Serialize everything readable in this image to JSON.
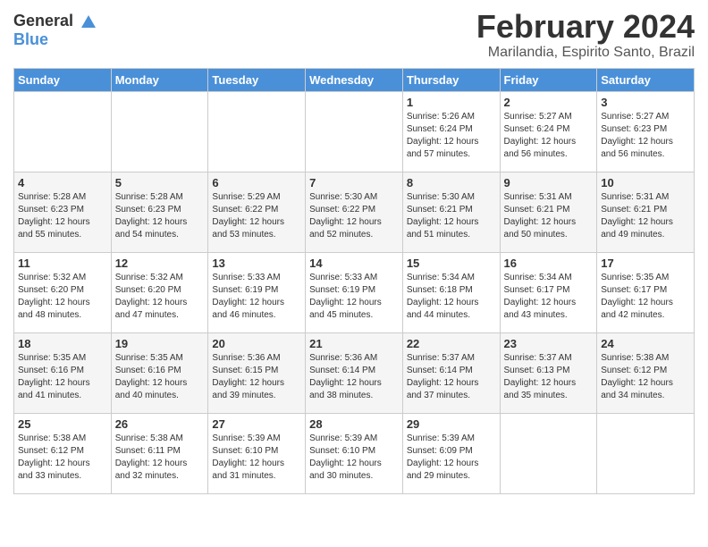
{
  "header": {
    "logo_general": "General",
    "logo_blue": "Blue",
    "month_title": "February 2024",
    "location": "Marilandia, Espirito Santo, Brazil"
  },
  "days_of_week": [
    "Sunday",
    "Monday",
    "Tuesday",
    "Wednesday",
    "Thursday",
    "Friday",
    "Saturday"
  ],
  "weeks": [
    [
      {
        "day": "",
        "info": ""
      },
      {
        "day": "",
        "info": ""
      },
      {
        "day": "",
        "info": ""
      },
      {
        "day": "",
        "info": ""
      },
      {
        "day": "1",
        "info": "Sunrise: 5:26 AM\nSunset: 6:24 PM\nDaylight: 12 hours\nand 57 minutes."
      },
      {
        "day": "2",
        "info": "Sunrise: 5:27 AM\nSunset: 6:24 PM\nDaylight: 12 hours\nand 56 minutes."
      },
      {
        "day": "3",
        "info": "Sunrise: 5:27 AM\nSunset: 6:23 PM\nDaylight: 12 hours\nand 56 minutes."
      }
    ],
    [
      {
        "day": "4",
        "info": "Sunrise: 5:28 AM\nSunset: 6:23 PM\nDaylight: 12 hours\nand 55 minutes."
      },
      {
        "day": "5",
        "info": "Sunrise: 5:28 AM\nSunset: 6:23 PM\nDaylight: 12 hours\nand 54 minutes."
      },
      {
        "day": "6",
        "info": "Sunrise: 5:29 AM\nSunset: 6:22 PM\nDaylight: 12 hours\nand 53 minutes."
      },
      {
        "day": "7",
        "info": "Sunrise: 5:30 AM\nSunset: 6:22 PM\nDaylight: 12 hours\nand 52 minutes."
      },
      {
        "day": "8",
        "info": "Sunrise: 5:30 AM\nSunset: 6:21 PM\nDaylight: 12 hours\nand 51 minutes."
      },
      {
        "day": "9",
        "info": "Sunrise: 5:31 AM\nSunset: 6:21 PM\nDaylight: 12 hours\nand 50 minutes."
      },
      {
        "day": "10",
        "info": "Sunrise: 5:31 AM\nSunset: 6:21 PM\nDaylight: 12 hours\nand 49 minutes."
      }
    ],
    [
      {
        "day": "11",
        "info": "Sunrise: 5:32 AM\nSunset: 6:20 PM\nDaylight: 12 hours\nand 48 minutes."
      },
      {
        "day": "12",
        "info": "Sunrise: 5:32 AM\nSunset: 6:20 PM\nDaylight: 12 hours\nand 47 minutes."
      },
      {
        "day": "13",
        "info": "Sunrise: 5:33 AM\nSunset: 6:19 PM\nDaylight: 12 hours\nand 46 minutes."
      },
      {
        "day": "14",
        "info": "Sunrise: 5:33 AM\nSunset: 6:19 PM\nDaylight: 12 hours\nand 45 minutes."
      },
      {
        "day": "15",
        "info": "Sunrise: 5:34 AM\nSunset: 6:18 PM\nDaylight: 12 hours\nand 44 minutes."
      },
      {
        "day": "16",
        "info": "Sunrise: 5:34 AM\nSunset: 6:17 PM\nDaylight: 12 hours\nand 43 minutes."
      },
      {
        "day": "17",
        "info": "Sunrise: 5:35 AM\nSunset: 6:17 PM\nDaylight: 12 hours\nand 42 minutes."
      }
    ],
    [
      {
        "day": "18",
        "info": "Sunrise: 5:35 AM\nSunset: 6:16 PM\nDaylight: 12 hours\nand 41 minutes."
      },
      {
        "day": "19",
        "info": "Sunrise: 5:35 AM\nSunset: 6:16 PM\nDaylight: 12 hours\nand 40 minutes."
      },
      {
        "day": "20",
        "info": "Sunrise: 5:36 AM\nSunset: 6:15 PM\nDaylight: 12 hours\nand 39 minutes."
      },
      {
        "day": "21",
        "info": "Sunrise: 5:36 AM\nSunset: 6:14 PM\nDaylight: 12 hours\nand 38 minutes."
      },
      {
        "day": "22",
        "info": "Sunrise: 5:37 AM\nSunset: 6:14 PM\nDaylight: 12 hours\nand 37 minutes."
      },
      {
        "day": "23",
        "info": "Sunrise: 5:37 AM\nSunset: 6:13 PM\nDaylight: 12 hours\nand 35 minutes."
      },
      {
        "day": "24",
        "info": "Sunrise: 5:38 AM\nSunset: 6:12 PM\nDaylight: 12 hours\nand 34 minutes."
      }
    ],
    [
      {
        "day": "25",
        "info": "Sunrise: 5:38 AM\nSunset: 6:12 PM\nDaylight: 12 hours\nand 33 minutes."
      },
      {
        "day": "26",
        "info": "Sunrise: 5:38 AM\nSunset: 6:11 PM\nDaylight: 12 hours\nand 32 minutes."
      },
      {
        "day": "27",
        "info": "Sunrise: 5:39 AM\nSunset: 6:10 PM\nDaylight: 12 hours\nand 31 minutes."
      },
      {
        "day": "28",
        "info": "Sunrise: 5:39 AM\nSunset: 6:10 PM\nDaylight: 12 hours\nand 30 minutes."
      },
      {
        "day": "29",
        "info": "Sunrise: 5:39 AM\nSunset: 6:09 PM\nDaylight: 12 hours\nand 29 minutes."
      },
      {
        "day": "",
        "info": ""
      },
      {
        "day": "",
        "info": ""
      }
    ]
  ]
}
